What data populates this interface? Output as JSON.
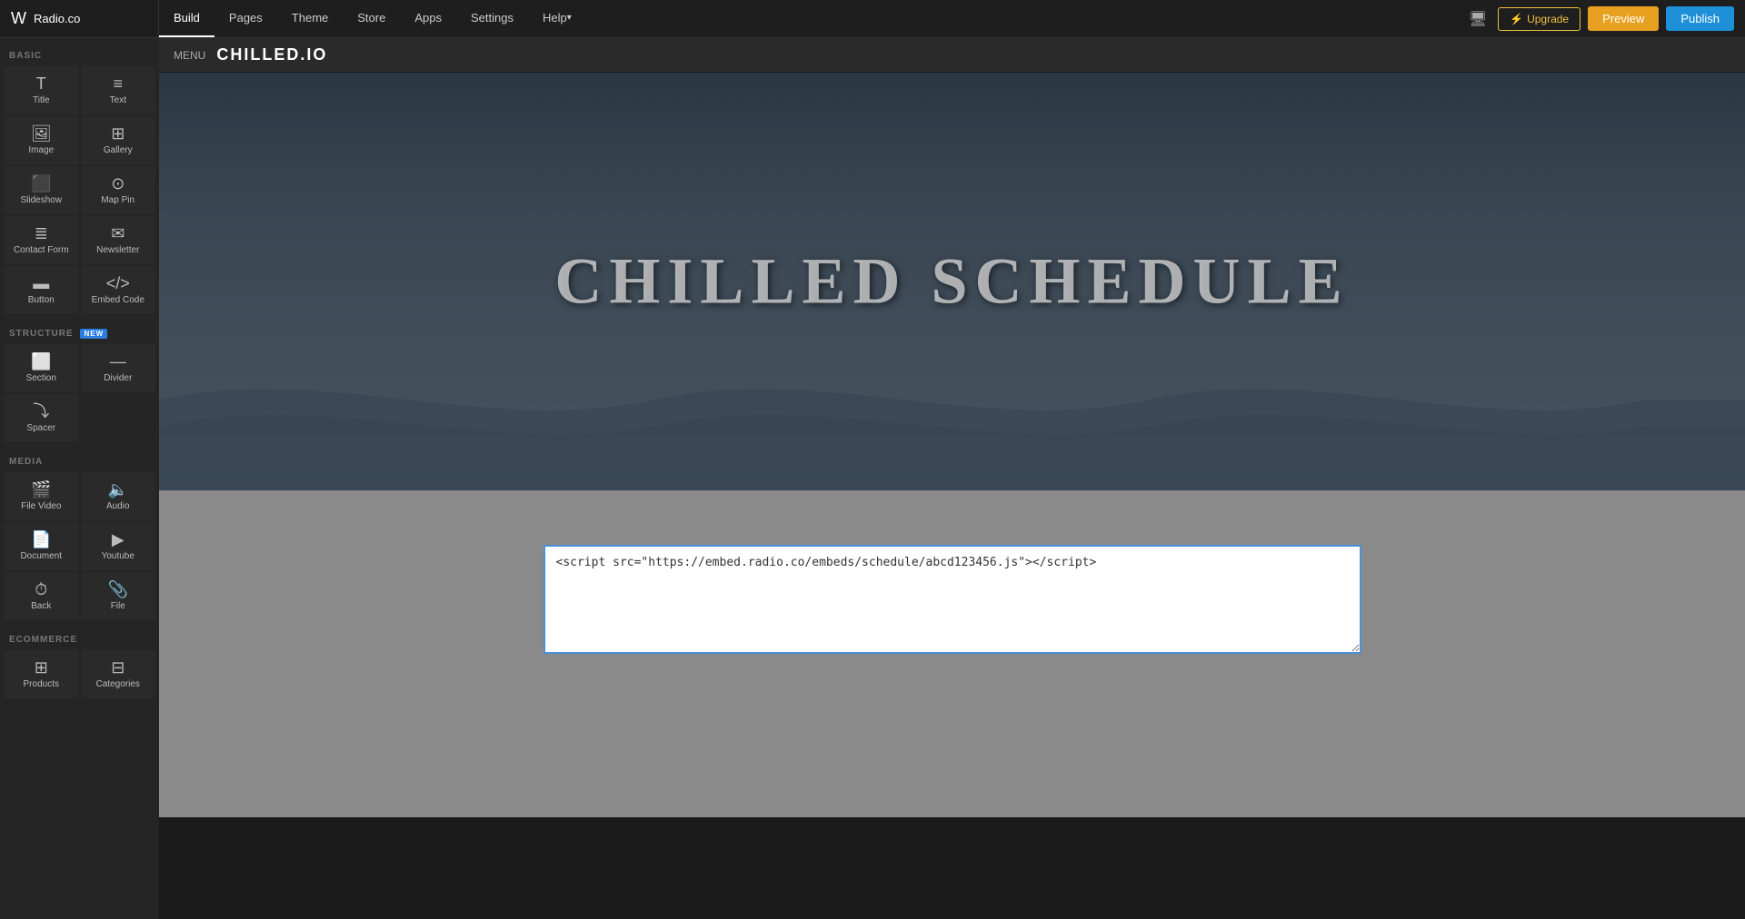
{
  "topNav": {
    "logoIcon": "W",
    "siteName": "Radio.co",
    "items": [
      {
        "label": "Build",
        "active": true
      },
      {
        "label": "Pages",
        "active": false
      },
      {
        "label": "Theme",
        "active": false
      },
      {
        "label": "Store",
        "active": false
      },
      {
        "label": "Apps",
        "active": false
      },
      {
        "label": "Settings",
        "active": false
      },
      {
        "label": "Help",
        "active": false,
        "hasArrow": true
      }
    ],
    "upgradeLabel": "Upgrade",
    "previewLabel": "Preview",
    "publishLabel": "Publish"
  },
  "sidebar": {
    "sections": [
      {
        "label": "BASIC",
        "items": [
          {
            "icon": "T",
            "label": "Title"
          },
          {
            "icon": "≡",
            "label": "Text"
          },
          {
            "icon": "🖼",
            "label": "Image"
          },
          {
            "icon": "⊞",
            "label": "Gallery"
          },
          {
            "icon": "▶",
            "label": "Slideshow"
          },
          {
            "icon": "📍",
            "label": "Map Pin"
          },
          {
            "icon": "📋",
            "label": "Contact Form"
          },
          {
            "icon": "✉",
            "label": "Newsletter"
          },
          {
            "icon": "▬",
            "label": "Button"
          },
          {
            "icon": "</>",
            "label": "Embed Code"
          }
        ]
      },
      {
        "label": "STRUCTURE",
        "new": true,
        "items": [
          {
            "icon": "⬜",
            "label": "Section"
          },
          {
            "icon": "⊟",
            "label": "Divider"
          },
          {
            "icon": "⊡",
            "label": "Spacer"
          }
        ]
      },
      {
        "label": "MEDIA",
        "items": [
          {
            "icon": "🎬",
            "label": "File Video"
          },
          {
            "icon": "🔊",
            "label": "Audio"
          },
          {
            "icon": "📄",
            "label": "Document"
          },
          {
            "icon": "▶",
            "label": "Youtube"
          },
          {
            "icon": "🕐",
            "label": "Back"
          },
          {
            "icon": "📎",
            "label": "File"
          }
        ]
      },
      {
        "label": "ECOMMERCE",
        "items": [
          {
            "icon": "⊞⊞",
            "label": "Products"
          },
          {
            "icon": "⊞",
            "label": "Categories"
          }
        ]
      }
    ]
  },
  "canvas": {
    "menuLabel": "MENU",
    "siteLogoText": "CHILLED.IO",
    "heroTitle": "CHILLED SCHEDULE",
    "embedCode": "<script src=\"https://embed.radio.co/embeds/schedule/abcd123456.js\"></script>"
  }
}
